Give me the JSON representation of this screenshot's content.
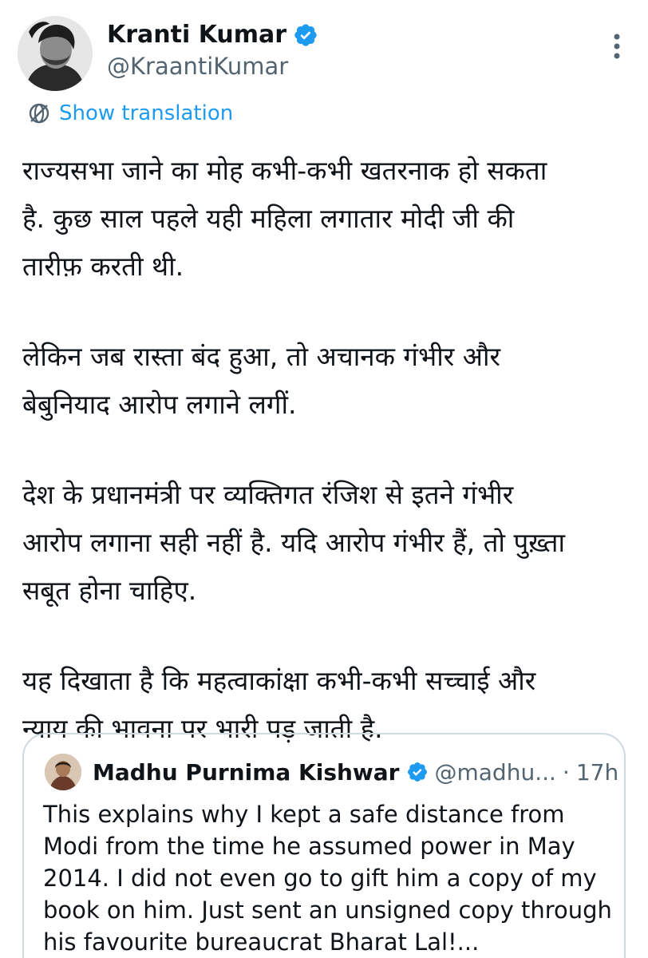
{
  "tweet": {
    "author_name": "Kranti Kumar",
    "author_handle": "@KraantiKumar",
    "translate_label": "Show translation",
    "paragraphs": [
      "राज्यसभा जाने का मोह कभी-कभी खतरनाक हो सकता\nहै. कुछ साल पहले यही महिला लगातार मोदी जी की\nतारीफ़ करती थी.",
      "लेकिन जब रास्ता बंद हुआ, तो अचानक गंभीर और\nबेबुनियाद आरोप लगाने लगीं.",
      "देश के प्रधानमंत्री पर व्यक्तिगत रंजिश से इतने गंभीर\nआरोप लगाना सही नहीं है. यदि आरोप गंभीर हैं, तो पुख़्ता\nसबूत होना चाहिए.",
      "यह दिखाता है कि महत्वाकांक्षा कभी-कभी सच्चाई और\nन्याय की भावना पर भारी पड़ जाती है."
    ]
  },
  "quoted_tweet": {
    "author_name": "Madhu Purnima Kishwar",
    "author_handle": "@madhu...",
    "separator": "·",
    "time": "17h",
    "text": "This explains why I kept a safe distance from\nModi from the time he assumed power in May\n2014. I did not even go to gift him a copy of my\nbook on him. Just sent an unsigned copy through\nhis favourite bureaucrat Bharat Lal!..."
  },
  "colors": {
    "text_primary": "#0f1419",
    "text_secondary": "#536471",
    "accent": "#1d9bf0",
    "border": "#cfd9de"
  },
  "icons": {
    "verified": "verified-badge-icon",
    "more": "more-vertical-icon",
    "translate": "translate-globe-icon"
  }
}
